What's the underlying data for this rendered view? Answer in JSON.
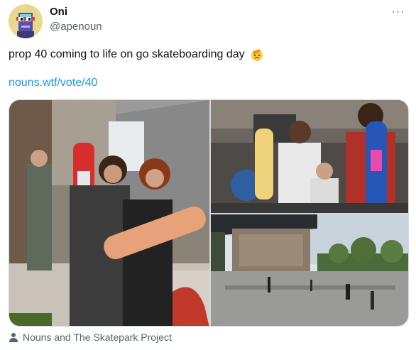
{
  "author": {
    "name": "Oni",
    "handle": "@apenoun",
    "avatar_icon": "noun-avatar"
  },
  "tweet": {
    "text": "prop 40 coming to life on go skateboarding day",
    "emoji_icon": "saluting-face-emoji",
    "link": "nouns.wtf/vote/40"
  },
  "media": {
    "photos": [
      {
        "name": "photo-skaters-holding-boards",
        "description_icon": "photo"
      },
      {
        "name": "photo-kids-with-skateboards",
        "description_icon": "photo"
      },
      {
        "name": "photo-skatepark-under-bridge",
        "description_icon": "photo"
      }
    ]
  },
  "caption": {
    "text": "Nouns and The Skatepark Project",
    "icon": "person-icon"
  },
  "colors": {
    "link": "#1d9bf0",
    "secondary_text": "#536471",
    "primary_text": "#0f1419"
  }
}
